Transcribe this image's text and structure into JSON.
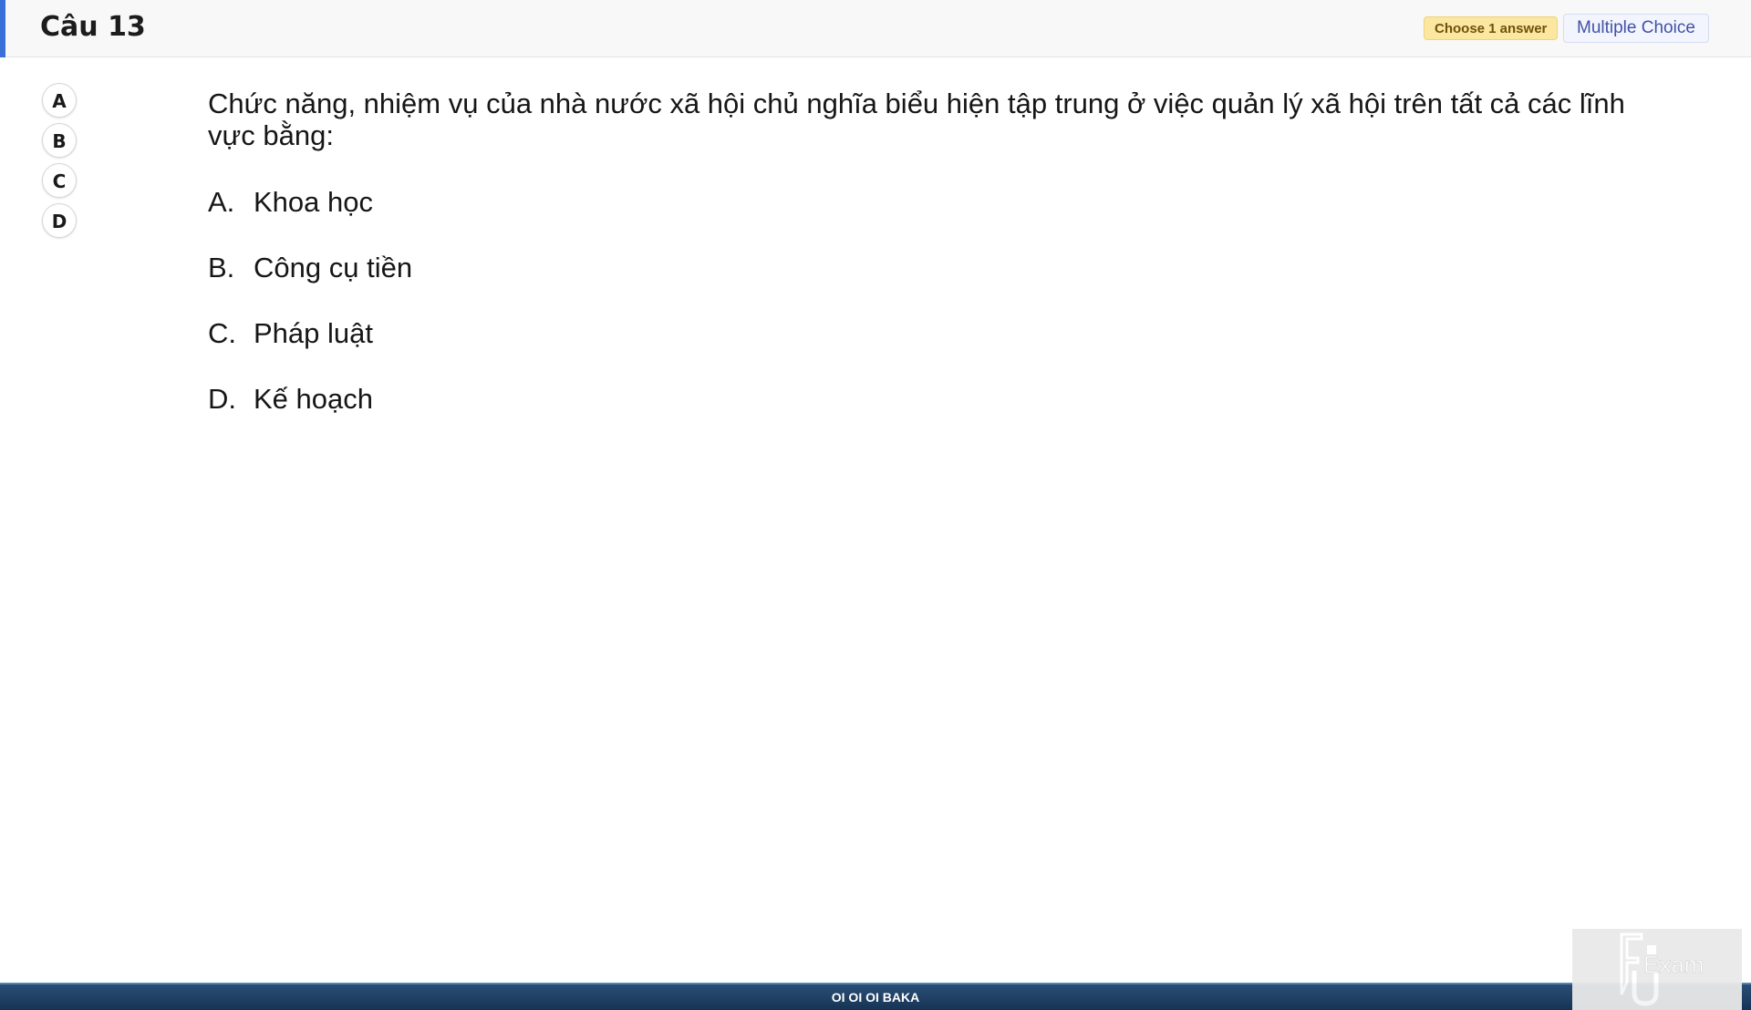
{
  "header": {
    "title": "Câu 13",
    "choose_badge": "Choose 1 answer",
    "type_badge": "Multiple Choice"
  },
  "answer_buttons": [
    {
      "label": "A"
    },
    {
      "label": "B"
    },
    {
      "label": "C"
    },
    {
      "label": "D"
    }
  ],
  "question": {
    "text": "Chức năng, nhiệm vụ của nhà nước xã hội chủ nghĩa biểu hiện tập trung ở việc quản lý xã hội trên tất cả các lĩnh vực bằng:",
    "options": [
      {
        "letter": "A.",
        "text": "Khoa học"
      },
      {
        "letter": "B.",
        "text": "Công cụ tiền"
      },
      {
        "letter": "C.",
        "text": "Pháp luật"
      },
      {
        "letter": "D.",
        "text": "Kế hoạch"
      }
    ]
  },
  "footer": {
    "text": "OI OI OI BAKA"
  },
  "logo": {
    "icon": "fu-exam-logo",
    "text": "Exam"
  },
  "colors": {
    "accent": "#3b6fd8",
    "choose_badge_bg": "#fbe7a1",
    "type_badge_text": "#4251a6",
    "footer_bg": "#1f3f66"
  }
}
